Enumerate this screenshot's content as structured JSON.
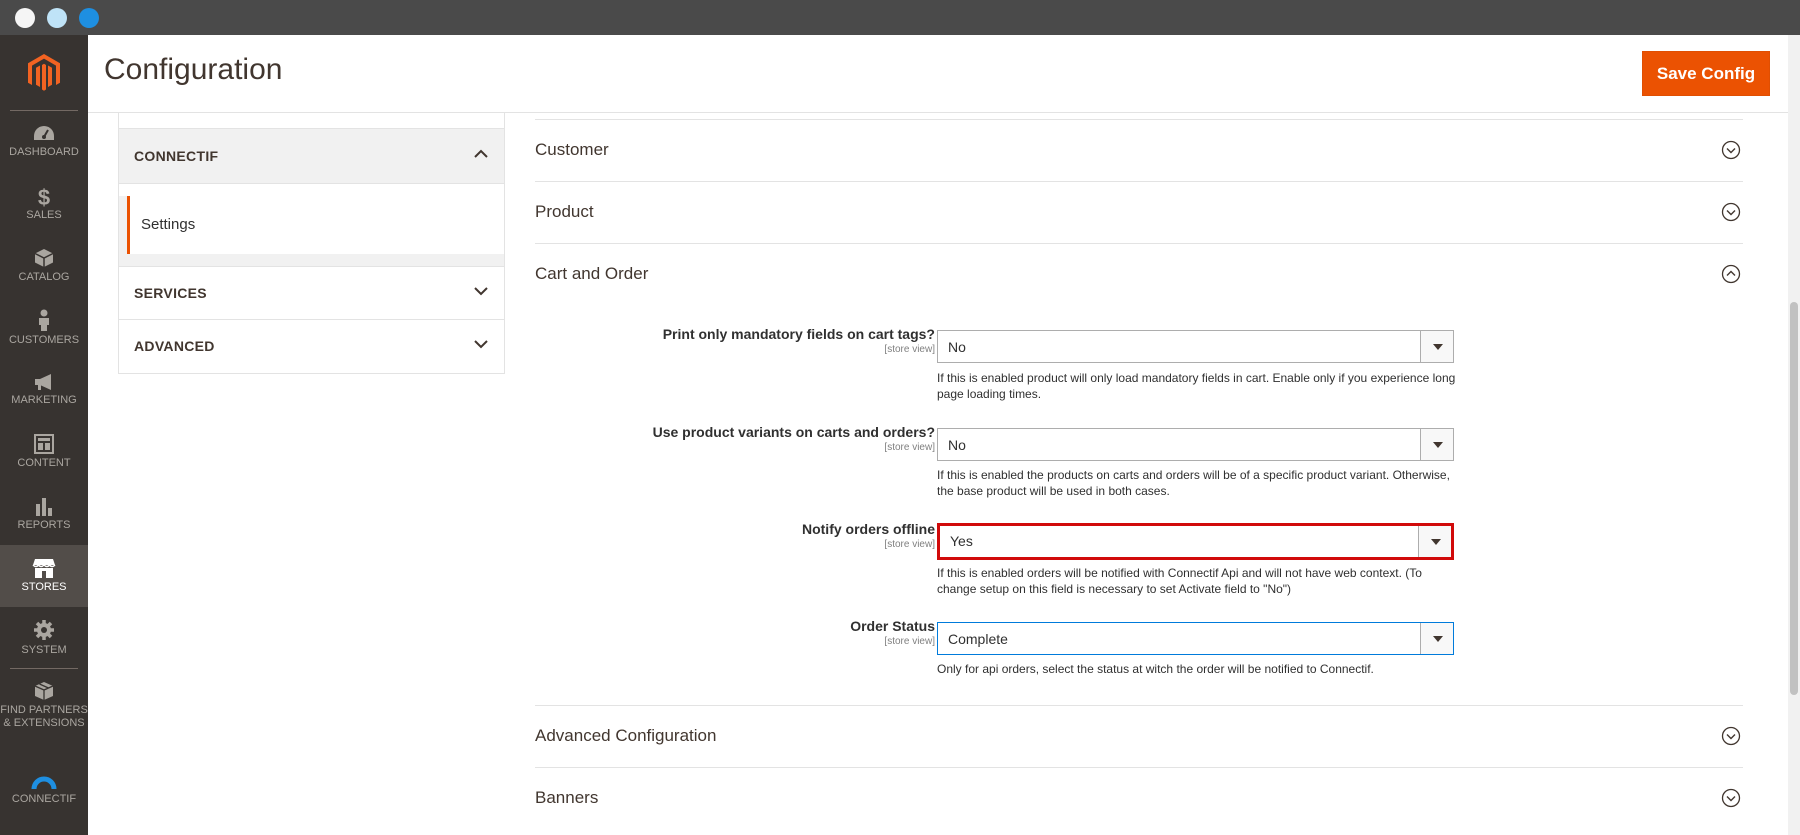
{
  "app": {
    "title": "Configuration",
    "save_label": "Save Config",
    "brand_color": "#eb5202"
  },
  "nav": {
    "items": [
      {
        "label": "DASHBOARD",
        "icon": "dashboard-icon"
      },
      {
        "label": "SALES",
        "icon": "dollar-icon"
      },
      {
        "label": "CATALOG",
        "icon": "box-icon"
      },
      {
        "label": "CUSTOMERS",
        "icon": "person-icon"
      },
      {
        "label": "MARKETING",
        "icon": "megaphone-icon"
      },
      {
        "label": "CONTENT",
        "icon": "layout-icon"
      },
      {
        "label": "REPORTS",
        "icon": "bar-chart-icon"
      },
      {
        "label": "STORES",
        "icon": "store-icon"
      },
      {
        "label": "SYSTEM",
        "icon": "gear-icon"
      },
      {
        "label": "FIND PARTNERS & EXTENSIONS",
        "icon": "blocks-icon"
      },
      {
        "label": "CONNECTIF",
        "icon": "connectif-icon"
      }
    ],
    "active": "STORES"
  },
  "tabs": {
    "connectif": {
      "title": "CONNECTIF",
      "items": [
        {
          "label": "Settings"
        }
      ]
    },
    "services": {
      "title": "SERVICES"
    },
    "advanced": {
      "title": "ADVANCED"
    }
  },
  "sections": {
    "customer": "Customer",
    "product": "Product",
    "cart": "Cart and Order",
    "advanced_config": "Advanced Configuration",
    "banners": "Banners"
  },
  "fields": [
    {
      "label": "Print only mandatory fields on cart tags?",
      "scope": "[store view]",
      "value": "No",
      "note": "If this is enabled product will only load mandatory fields in cart. Enable only if you experience long page loading times."
    },
    {
      "label": "Use product variants on carts and orders?",
      "scope": "[store view]",
      "value": "No",
      "note": "If this is enabled the products on carts and orders will be of a specific product variant. Otherwise, the base product will be used in both cases."
    },
    {
      "label": "Notify orders offline",
      "scope": "[store view]",
      "value": "Yes",
      "note": "If this is enabled orders will be notified with Connectif Api and will not have web context. (To change setup on this field is necessary to set Activate field to \"No\")"
    },
    {
      "label": "Order Status",
      "scope": "[store view]",
      "value": "Complete",
      "note": "Only for api orders, select the status at witch the order will be notified to Connectif."
    }
  ]
}
